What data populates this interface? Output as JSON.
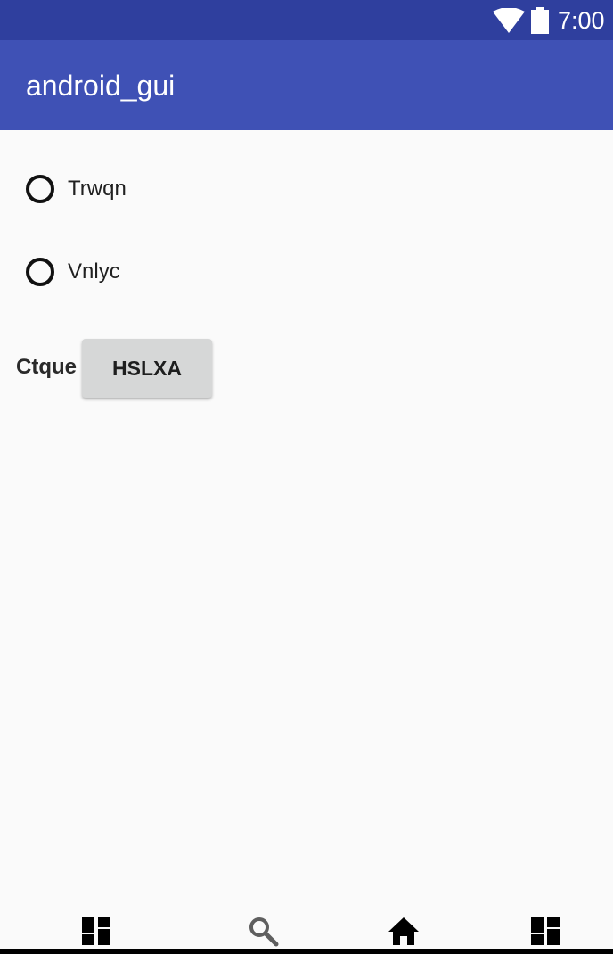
{
  "status_bar": {
    "time": "7:00",
    "icons": [
      "wifi-icon",
      "battery-icon"
    ],
    "background_color": "#2f3f9e"
  },
  "app_bar": {
    "title": "android_gui",
    "background_color": "#3f51b5"
  },
  "radio_group": {
    "options": [
      {
        "label": "Trwqn",
        "selected": false
      },
      {
        "label": "Vnlyc",
        "selected": false
      }
    ]
  },
  "form": {
    "field_label": "Ctque",
    "button_label": "HSLXA"
  },
  "bottom_nav": {
    "items": [
      "dashboard-icon",
      "search-icon",
      "home-icon",
      "dashboard-icon"
    ]
  }
}
